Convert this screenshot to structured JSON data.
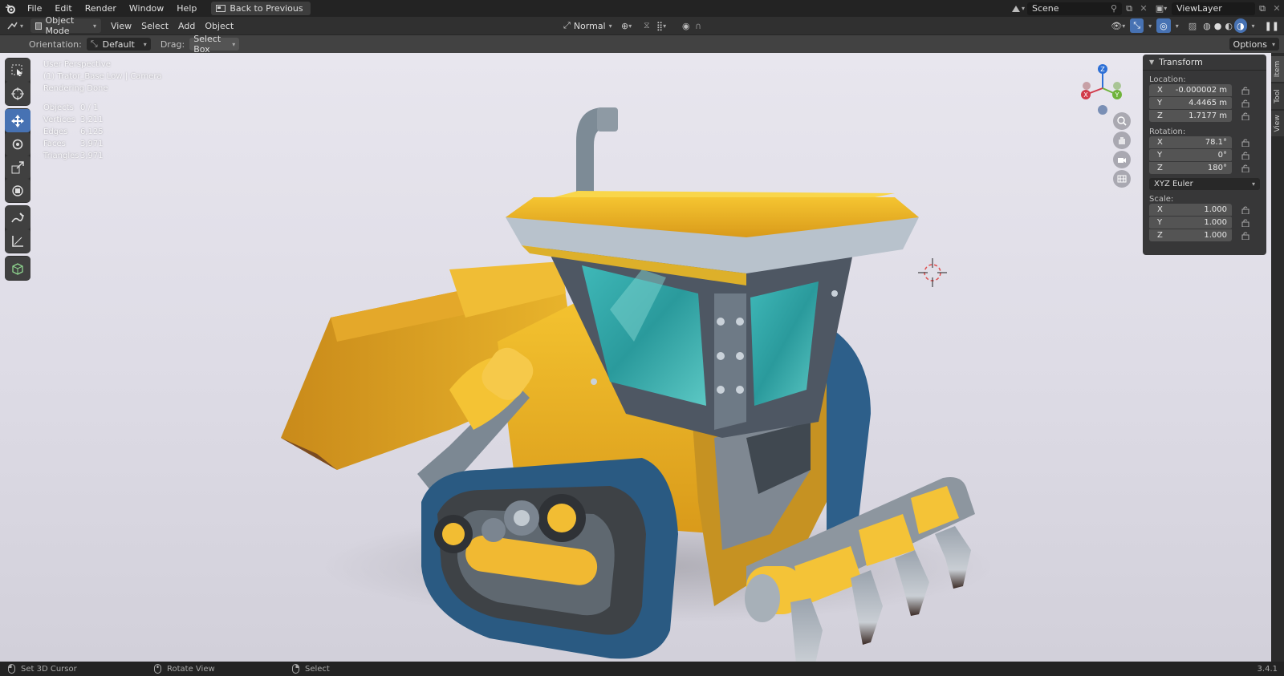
{
  "menubar": {
    "items": [
      "File",
      "Edit",
      "Render",
      "Window",
      "Help"
    ],
    "back_button": "Back to Previous",
    "scene": "Scene",
    "view_layer": "ViewLayer"
  },
  "header": {
    "mode": "Object Mode",
    "menus": [
      "View",
      "Select",
      "Add",
      "Object"
    ],
    "transform_orientation": "Normal"
  },
  "tool_settings": {
    "orientation_label": "Orientation:",
    "orientation_value": "Default",
    "drag_label": "Drag:",
    "drag_value": "Select Box",
    "options": "Options"
  },
  "viewport_overlay": {
    "view_name": "User Perspective",
    "object_info": "(1) Trator_Base Low | Camera",
    "render_status": "Rendering Done",
    "stats": [
      {
        "label": "Objects",
        "value": "0 / 1"
      },
      {
        "label": "Vertices",
        "value": "3,211"
      },
      {
        "label": "Edges",
        "value": "6,125"
      },
      {
        "label": "Faces",
        "value": "3,971"
      },
      {
        "label": "Triangles",
        "value": "3,971"
      }
    ]
  },
  "gizmo": {
    "x": "X",
    "y": "Y",
    "z": "Z"
  },
  "transform_panel": {
    "title": "Transform",
    "location_label": "Location:",
    "location": [
      {
        "axis": "X",
        "value": "-0.000002 m"
      },
      {
        "axis": "Y",
        "value": "4.4465 m"
      },
      {
        "axis": "Z",
        "value": "1.7177 m"
      }
    ],
    "rotation_label": "Rotation:",
    "rotation": [
      {
        "axis": "X",
        "value": "78.1°"
      },
      {
        "axis": "Y",
        "value": "0°"
      },
      {
        "axis": "Z",
        "value": "180°"
      }
    ],
    "rotation_mode": "XYZ Euler",
    "scale_label": "Scale:",
    "scale": [
      {
        "axis": "X",
        "value": "1.000"
      },
      {
        "axis": "Y",
        "value": "1.000"
      },
      {
        "axis": "Z",
        "value": "1.000"
      }
    ]
  },
  "sidebar_tabs": [
    "Item",
    "Tool",
    "View"
  ],
  "statusbar": {
    "left": "Set 3D Cursor",
    "middle": "Rotate View",
    "right": "Select",
    "version": "3.4.1"
  }
}
